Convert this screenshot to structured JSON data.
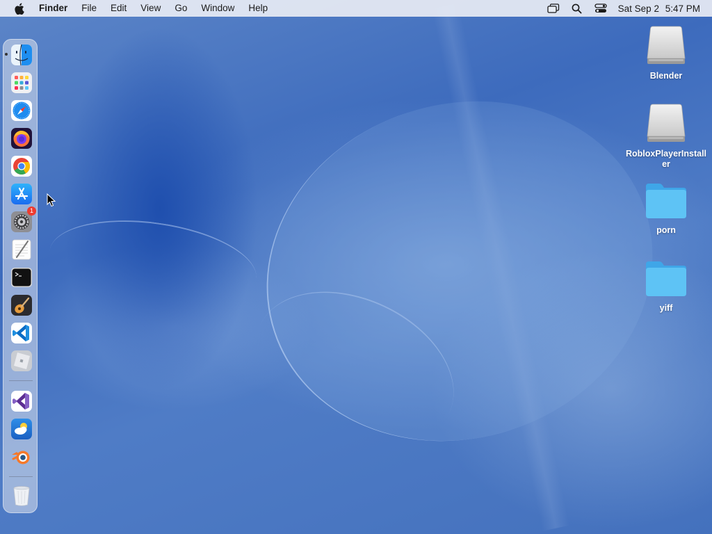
{
  "menubar": {
    "app_name": "Finder",
    "menus": [
      "File",
      "Edit",
      "View",
      "Go",
      "Window",
      "Help"
    ],
    "status_icons": [
      "screen-mirroring-icon",
      "spotlight-search-icon",
      "control-center-icon"
    ],
    "clock": {
      "date": "Sat Sep 2",
      "time": "5:47 PM"
    }
  },
  "dock": {
    "items": [
      {
        "name": "finder",
        "icon": "finder-icon",
        "running": true
      },
      {
        "name": "launchpad",
        "icon": "launchpad-icon"
      },
      {
        "name": "safari",
        "icon": "safari-icon"
      },
      {
        "name": "firefox",
        "icon": "firefox-icon"
      },
      {
        "name": "chrome",
        "icon": "chrome-icon"
      },
      {
        "name": "app-store",
        "icon": "app-store-icon"
      },
      {
        "name": "system-settings",
        "icon": "system-settings-icon",
        "badge": "1"
      },
      {
        "name": "textedit",
        "icon": "textedit-icon"
      },
      {
        "name": "terminal",
        "icon": "terminal-icon"
      },
      {
        "name": "garageband",
        "icon": "garageband-icon"
      },
      {
        "name": "vscode",
        "icon": "vscode-icon"
      },
      {
        "name": "roblox",
        "icon": "roblox-icon"
      },
      {
        "name": "visual-studio",
        "icon": "visual-studio-icon"
      },
      {
        "name": "weather",
        "icon": "weather-icon"
      },
      {
        "name": "blender",
        "icon": "blender-icon"
      },
      {
        "name": "trash",
        "icon": "trash-icon"
      }
    ]
  },
  "desktop_icons": [
    {
      "label": "Blender",
      "type": "disk-image-icon"
    },
    {
      "label": "RobloxPlayerInstaller",
      "type": "disk-image-icon"
    },
    {
      "label": "porn",
      "type": "folder-icon"
    },
    {
      "label": "yiff",
      "type": "folder-icon"
    }
  ],
  "colors": {
    "desktop_blue": "#3d6bbd",
    "folder_blue": "#5ec3f5",
    "badge_red": "#ee3b2f"
  }
}
